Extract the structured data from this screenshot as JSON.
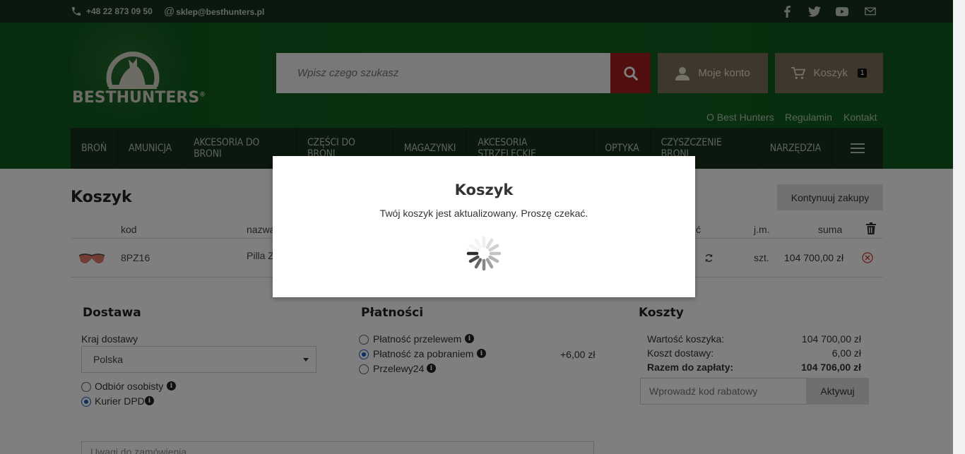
{
  "topbar": {
    "phone": "+48 22 873 09 50",
    "email": "sklep@besthunters.pl",
    "social_icons": [
      "facebook-icon",
      "twitter-icon",
      "youtube-icon",
      "mail-icon"
    ]
  },
  "header": {
    "logo_text": "BESTHUNTERS",
    "logo_mark": "®",
    "search_placeholder": "Wpisz czego szukasz",
    "account_label": "Moje konto",
    "cart_label": "Koszyk",
    "cart_count": "1",
    "links": [
      "O Best Hunters",
      "Regulamin",
      "Kontakt"
    ]
  },
  "nav": {
    "items": [
      "BROŃ",
      "AMUNICJA",
      "AKCESORIA DO BRONI",
      "CZĘŚCI DO BRONI",
      "MAGAZYNKI",
      "AKCESORIA STRZELECKIE",
      "OPTYKA",
      "CZYSZCZENIE BRONI",
      "NARZĘDZIA"
    ],
    "menu_icon": "hamburger-icon"
  },
  "cart": {
    "title": "Koszyk",
    "continue_label": "Kontynuuj zakupy",
    "columns": {
      "code": "kod",
      "name": "nazwa",
      "qty_fragment": "ć",
      "unit": "j.m.",
      "sum": "suma"
    },
    "row": {
      "code": "8PZ16",
      "name_fragment": "Pilla Z",
      "unit": "szt.",
      "sum": "104 700,00 zł"
    }
  },
  "delivery": {
    "title": "Dostawa",
    "country_label": "Kraj dostawy",
    "country_value": "Polska",
    "options": [
      {
        "label": "Odbiór osobisty",
        "selected": false
      },
      {
        "label": "Kurier DPD",
        "selected": true
      }
    ]
  },
  "payment": {
    "title": "Płatności",
    "options": [
      {
        "label": "Płatność przelewem",
        "selected": false,
        "extra": ""
      },
      {
        "label": "Płatność za pobraniem",
        "selected": true,
        "extra": "+6,00 zł"
      },
      {
        "label": "Przelewy24",
        "selected": false,
        "extra": ""
      }
    ]
  },
  "costs": {
    "title": "Koszty",
    "cart_value_label": "Wartość koszyka:",
    "cart_value": "104 700,00 zł",
    "shipping_label": "Koszt dostawy:",
    "shipping_value": "6,00 zł",
    "total_label": "Razem do zapłaty:",
    "total_value": "104 706,00 zł",
    "coupon_placeholder": "Wprowadź kod rabatowy",
    "activate_label": "Aktywuj"
  },
  "notes_placeholder": "Uwagi do zamówienia",
  "modal": {
    "title": "Koszyk",
    "message": "Twój koszyk jest aktualizowany. Proszę czekać."
  },
  "colors": {
    "dark_green": "#14301a",
    "header_green": "#0d5a1c",
    "search_red": "#a41e1e",
    "brown": "#7b7057",
    "radio_blue": "#1f5cc4"
  }
}
